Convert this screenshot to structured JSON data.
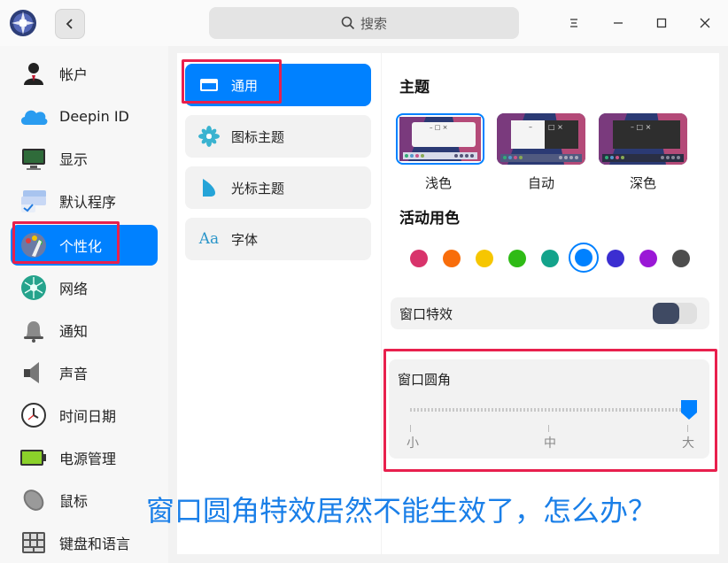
{
  "titlebar": {
    "search_placeholder": "搜索",
    "icons": [
      "app-logo-icon",
      "chevron-left-icon",
      "search-icon",
      "menu-icon",
      "minimize-icon",
      "maximize-icon",
      "close-icon"
    ]
  },
  "sidebar": {
    "items": [
      {
        "label": "帐户",
        "icon": "account-icon"
      },
      {
        "label": "Deepin ID",
        "icon": "cloud-icon"
      },
      {
        "label": "显示",
        "icon": "display-icon"
      },
      {
        "label": "默认程序",
        "icon": "default-apps-icon"
      },
      {
        "label": "个性化",
        "icon": "personalization-icon",
        "active": true
      },
      {
        "label": "网络",
        "icon": "network-icon"
      },
      {
        "label": "通知",
        "icon": "bell-icon"
      },
      {
        "label": "声音",
        "icon": "speaker-icon"
      },
      {
        "label": "时间日期",
        "icon": "clock-icon"
      },
      {
        "label": "电源管理",
        "icon": "battery-icon"
      },
      {
        "label": "鼠标",
        "icon": "mouse-icon"
      },
      {
        "label": "键盘和语言",
        "icon": "keyboard-icon"
      }
    ]
  },
  "submenu": {
    "items": [
      {
        "label": "通用",
        "icon": "window-icon",
        "active": true
      },
      {
        "label": "图标主题",
        "icon": "flower-icon"
      },
      {
        "label": "光标主题",
        "icon": "cursor-icon"
      },
      {
        "label": "字体",
        "icon": "font-icon",
        "glyph": "Aa"
      }
    ]
  },
  "content": {
    "theme_title": "主题",
    "themes": [
      {
        "label": "浅色",
        "selected": true
      },
      {
        "label": "自动"
      },
      {
        "label": "深色"
      }
    ],
    "accent_title": "活动用色",
    "accent_colors": [
      "#d8336b",
      "#f86d0b",
      "#f6c600",
      "#2fbb16",
      "#13a38b",
      "#0081ff",
      "#3b2ed1",
      "#9a18d6",
      "#4d4d4d"
    ],
    "accent_selected": "#0081ff",
    "window_effect_label": "窗口特效",
    "window_effect_on": false,
    "corner_label": "窗口圆角",
    "corner_ticks": [
      "小",
      "中",
      "大"
    ],
    "corner_value": "大"
  },
  "overlay": {
    "caption": "窗口圆角特效居然不能生效了，怎么办？"
  },
  "colors": {
    "accent": "#0081ff",
    "highlight_box": "#e8204d",
    "caption": "#1a7fe8"
  }
}
